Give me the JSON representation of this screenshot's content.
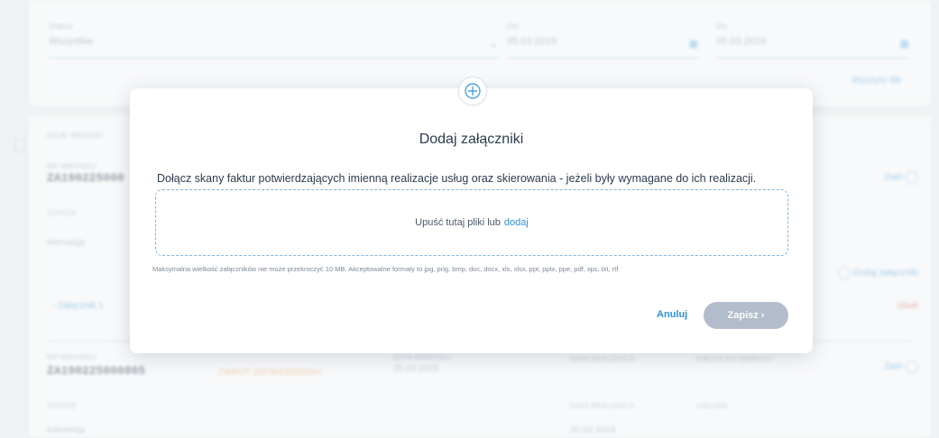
{
  "filters": {
    "status_label": "Status",
    "status_value": "Wszystkie",
    "from_label": "Od",
    "from_value": "05.03.2019",
    "to_label": "Do",
    "to_value": "05.03.2019",
    "clear_label": "Wyczyść filtr"
  },
  "list": {
    "section_title": "MOJE WNIOSKI",
    "row1": {
      "number_label": "NR WNIOSKU",
      "number": "ZA190225000",
      "status_label": "STATUS",
      "status_value": "Interwizja",
      "collapse_label": "Zwiń",
      "add_attachments_label": "Dodaj załączniki",
      "attachment_label": "Załącznik 1",
      "remove_label": "Usuń"
    },
    "row2": {
      "number_label": "NR WNIOSKU",
      "number": "ZA190225000865",
      "badge": "ZWROT ZATWIERDZONY",
      "date_label": "DATA WNIOSKU",
      "date_value": "25.02.2019",
      "date_col": "DATA REALIZACJI",
      "amount_col": "KWOTA DO ZWROTU",
      "status_label": "STATUS",
      "status_value": "Interwizja",
      "realization_label": "DATA REALIZACJI",
      "realization_value": "20.02.2019",
      "service_label": "USŁUGA",
      "collapse_label": "Zwiń"
    }
  },
  "modal": {
    "icon": "attachment-plus-icon",
    "title": "Dodaj załączniki",
    "description": "Dołącz skany faktur potwierdzających imienną realizacje usług oraz skierowania - jeżeli były wymagane do ich realizacji.",
    "dropzone_text": "Upuść tutaj pliki lub",
    "dropzone_link": "dodaj",
    "hint": "Maksymalna wielkość załączników nie może przekroczyć 10 MB. Akceptowalne formaty to jpg, png, bmp, doc, docx, xls, xlsx, ppt, pptx, ppe, pdf, xps, txt, rtf",
    "cancel_label": "Anuluj",
    "save_label": "Zapisz ›"
  },
  "colors": {
    "accent": "#2d8fd8",
    "save_disabled": "#b3bccb"
  }
}
